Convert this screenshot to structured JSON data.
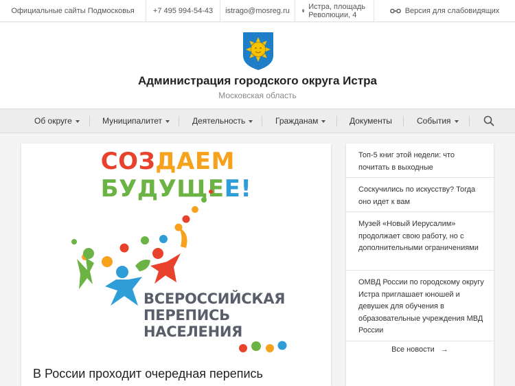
{
  "topbar": {
    "official_sites": "Официальные сайты Подмосковья",
    "phone": "+7 495 994-54-43",
    "email": "istrago@mosreg.ru",
    "address_line1": "Истра, площадь",
    "address_line2": "Революции, 4",
    "accessibility": "Версия для слабовидящих"
  },
  "header": {
    "title": "Администрация городского округа Истра",
    "subtitle": "Московская область",
    "crest_colors": {
      "shield": "#1e7fc8",
      "sun": "#f5c400"
    }
  },
  "nav": {
    "items": [
      {
        "label": "Об округе",
        "dropdown": true
      },
      {
        "label": "Муниципалитет",
        "dropdown": true
      },
      {
        "label": "Деятельность",
        "dropdown": true
      },
      {
        "label": "Гражданам",
        "dropdown": true
      },
      {
        "label": "Документы",
        "dropdown": false
      },
      {
        "label": "События",
        "dropdown": true
      }
    ],
    "search_icon": "search-icon"
  },
  "main": {
    "promo_headline_part1": "СОЗДАЕМ",
    "promo_headline_part2": "БУДУЩЕЕ!",
    "census_line1": "ВСЕРОССИЙСКАЯ",
    "census_line2": "ПЕРЕПИСЬ",
    "census_line3": "НАСЕЛЕНИЯ",
    "news_title": "В России проходит очередная перепись"
  },
  "sidebar": {
    "news": [
      {
        "text": "Топ-5 книг этой недели: что почитать в выходные"
      },
      {
        "text": "Соскучились по искусству? Тогда оно идет к вам"
      },
      {
        "text": "Музей «Новый Иерусалим» продолжает свою работу, но с дополнительными ограничениями"
      },
      {
        "text": "ОМВД России по городскому округу Истра приглашает юношей и девушек для обучения в образовательные учреждения МВД России"
      }
    ],
    "all_news": "Все новости",
    "arrow": "→"
  },
  "colors": {
    "accent_red": "#e8412c",
    "accent_green": "#6ab344",
    "accent_blue": "#2f9ed8",
    "accent_orange": "#f6a21d"
  }
}
